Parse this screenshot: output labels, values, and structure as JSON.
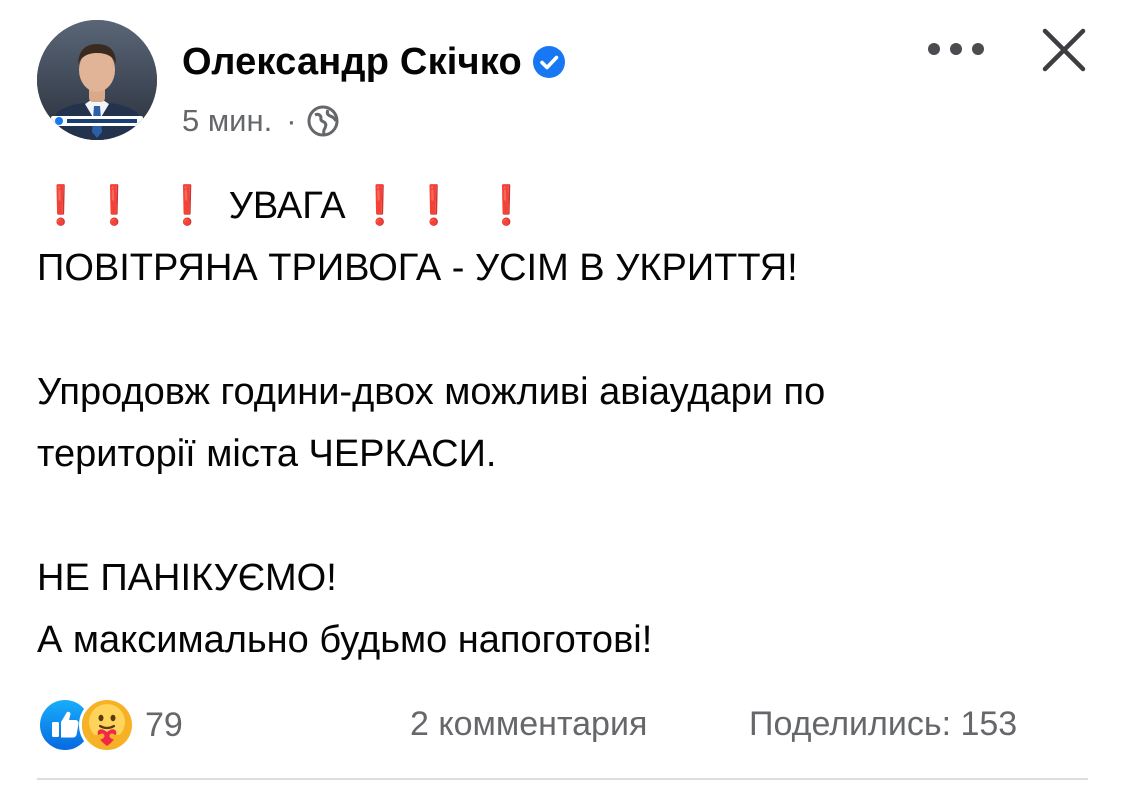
{
  "post": {
    "author": "Олександр Скічко",
    "verified": true,
    "time": "5 мин.",
    "separator": "·",
    "privacy_icon": "globe-icon",
    "lines": {
      "alert_word": "УВАГА",
      "exclamation": "❗",
      "line2": "ПОВІТРЯНА ТРИВОГА - УСІМ В УКРИТТЯ!",
      "line3": "Упродовж години-двох можливі авіаудари по",
      "line4": "території міста ЧЕРКАСИ.",
      "line5": "НЕ ПАНІКУЄМО!",
      "line6": "А максимально будьмо напоготові!"
    }
  },
  "footer": {
    "reaction_icons": [
      "like-icon",
      "care-icon"
    ],
    "reaction_count": "79",
    "comments": "2 комментария",
    "shares": "Поделились: 153"
  },
  "colors": {
    "accent": "#1877f2",
    "exclamation": "#e3172b",
    "muted": "#65676b",
    "text": "#050505"
  }
}
